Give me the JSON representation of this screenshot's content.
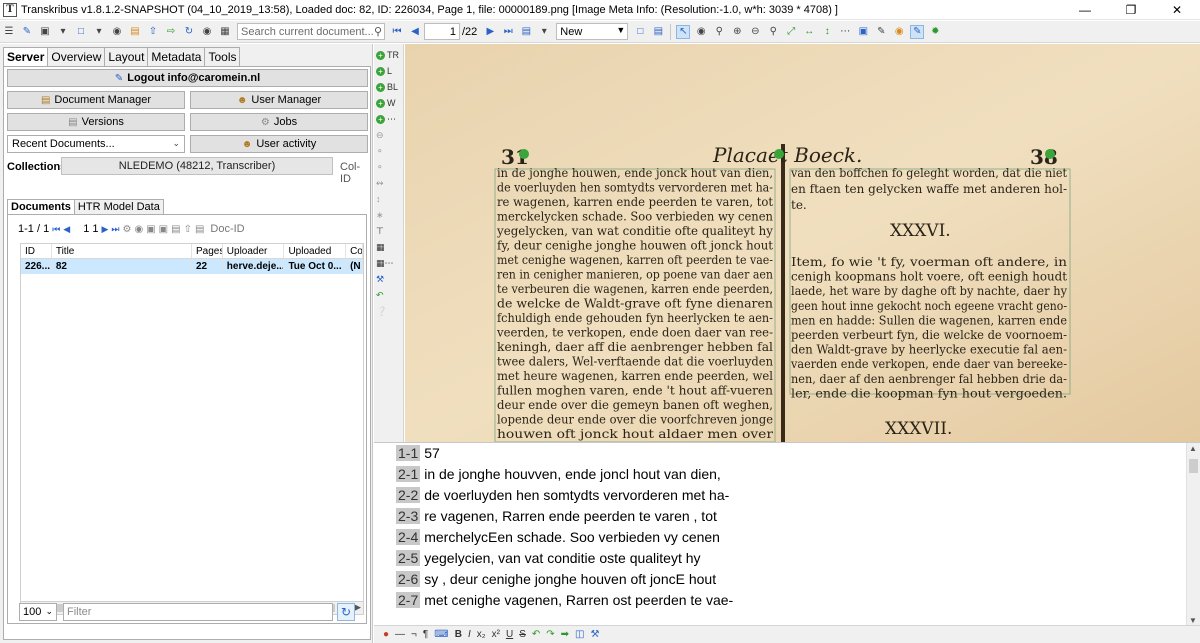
{
  "window": {
    "title": "Transkribus v1.8.1.2-SNAPSHOT (04_10_2019_13:58), Loaded doc: 82, ID: 226034, Page 1, file: 00000189.png [Image Meta Info: (Resolution:-1.0, w*h: 3039 * 4708) ]",
    "app_icon_letter": "T"
  },
  "toolbar": {
    "search_placeholder": "Search current document...",
    "page_value": "1",
    "page_total": "/22",
    "status_select": "New"
  },
  "left_tabs": [
    "Server",
    "Overview",
    "Layout",
    "Metadata",
    "Tools"
  ],
  "server": {
    "logout_label": "Logout info@caromein.nl",
    "document_manager": "Document Manager",
    "user_manager": "User Manager",
    "versions": "Versions",
    "jobs": "Jobs",
    "recent_documents": "Recent Documents...",
    "user_activity": "User activity",
    "collections_label": "Collections:",
    "collection_value": "NLEDEMO (48212, Transcriber)",
    "col_id_label": "Col-ID"
  },
  "sub_tabs": [
    "Documents",
    "HTR Model Data"
  ],
  "documents": {
    "range": "1-1 / 1",
    "page_field": "1",
    "page_of": "1",
    "doc_id_label": "Doc-ID",
    "columns": [
      "ID",
      "Title",
      "Pages",
      "Uploader",
      "Uploaded",
      "Co"
    ],
    "rows": [
      [
        "226...",
        "82",
        "22",
        "herve.deje...",
        "Tue Oct 0...",
        "(N"
      ]
    ],
    "page_size": "100",
    "filter_placeholder": "Filter"
  },
  "vertical_tools": [
    "TR",
    "L",
    "BL",
    "W"
  ],
  "page_image": {
    "header_left_num": "31",
    "header_title": "Placaet Boeck.",
    "header_right_num": "38",
    "left_column": [
      "in de jonghe houwen, ende jonck hout van dien,",
      "de voerluyden hen somtydts vervorderen met ha-",
      "re wagenen, karren ende peerden te varen, tot",
      "merckelycken schade. Soo verbieden wy cenen",
      "yegelycken, van wat conditie ofte qualiteyt hy",
      "fy, deur cenighe jonghe houwen oft jonck hout",
      "met cenighe wagenen, karren oft peerden te vae-",
      "ren in cenigher manieren, op poene van daer aen",
      "te verbeuren die wagenen, karren ende peerden,",
      "de welcke de Waldt-grave oft fyne dienaren",
      "fchuldigh ende gehouden fyn heerlycken te aen-",
      "veerden, te verkopen, ende doen daer van ree-",
      "keningh, daer aff die aenbrenger hebben fal",
      "twee dalers, Wel-verftaende dat die voerluyden",
      "met heure wagenen, karren ende peerden, wel",
      "fullen moghen varen, ende 't hout aff-vueren",
      "deur ende over die gemeyn banen oft weghen,",
      "lopende deur ende over die voorfchreven jonge",
      "houwen oft jonck hout aldaer men over"
    ],
    "right_column_top": [
      "van den boffchen fo geleght worden, dat die niet",
      "en ftaen ten gelycken waffe met anderen hol-",
      "te."
    ],
    "right_heading_1": "XXXVI.",
    "right_column_mid": [
      "Item, fo wie 't fy, voerman oft andere, in",
      "cenigh koopmans holt voere, oft eenigh houdt",
      "laede, het ware by daghe oft by nachte, daer hy",
      "geen hout inne gekocht noch egeene vracht geno-",
      "men en hadde: Sullen die wagenen, karren ende",
      "peerden verbeurt fyn, die welcke de voornoem-",
      "den Waldt-grave by heerlycke executie fal aen-",
      "vaerden ende verkopen, ende daer van bereeke-",
      "nen, daer af den aenbrenger fal hebben drie da-",
      "ler, ende die koopman fyn hout vergoeden."
    ],
    "right_heading_2": "XXXVII."
  },
  "transcription": [
    {
      "num": "1-1",
      "text": "57"
    },
    {
      "num": "2-1",
      "text": "in de jonghe houvven, ende joncl hout van dien,"
    },
    {
      "num": "2-2",
      "text": "de voerluyden hen somtydts vervorderen met ha-"
    },
    {
      "num": "2-3",
      "text": "re vagenen, Rarren ende peerden te varen , tot"
    },
    {
      "num": "2-4",
      "text": "merchelycEen schade. Soo verbieden vy cenen"
    },
    {
      "num": "2-5",
      "text": "yegelycien, van vat conditie oste qualiteyt hy"
    },
    {
      "num": "2-6",
      "text": "sy , deur cenighe jonghe houven oft joncE hout"
    },
    {
      "num": "2-7",
      "text": "met cenighe vagenen, Rarren ost peerden te vae-"
    }
  ]
}
